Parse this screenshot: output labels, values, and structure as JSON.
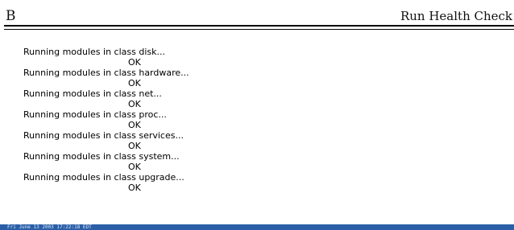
{
  "header": {
    "left_label": "B",
    "title": "Run Health Check"
  },
  "output": {
    "lines": [
      {
        "message": "Running modules in class disk...",
        "status": "OK"
      },
      {
        "message": "Running modules in class hardware...",
        "status": "OK"
      },
      {
        "message": "Running modules in class net...",
        "status": "OK"
      },
      {
        "message": "Running modules in class proc...",
        "status": "OK"
      },
      {
        "message": "Running modules in class services...",
        "status": "OK"
      },
      {
        "message": "Running modules in class system...",
        "status": "OK"
      },
      {
        "message": "Running modules in class upgrade...",
        "status": "OK"
      }
    ]
  },
  "statusbar": {
    "timestamp": "Fri June 13 2003 17:22:18 EDT",
    "color": "#2a5fa8"
  }
}
